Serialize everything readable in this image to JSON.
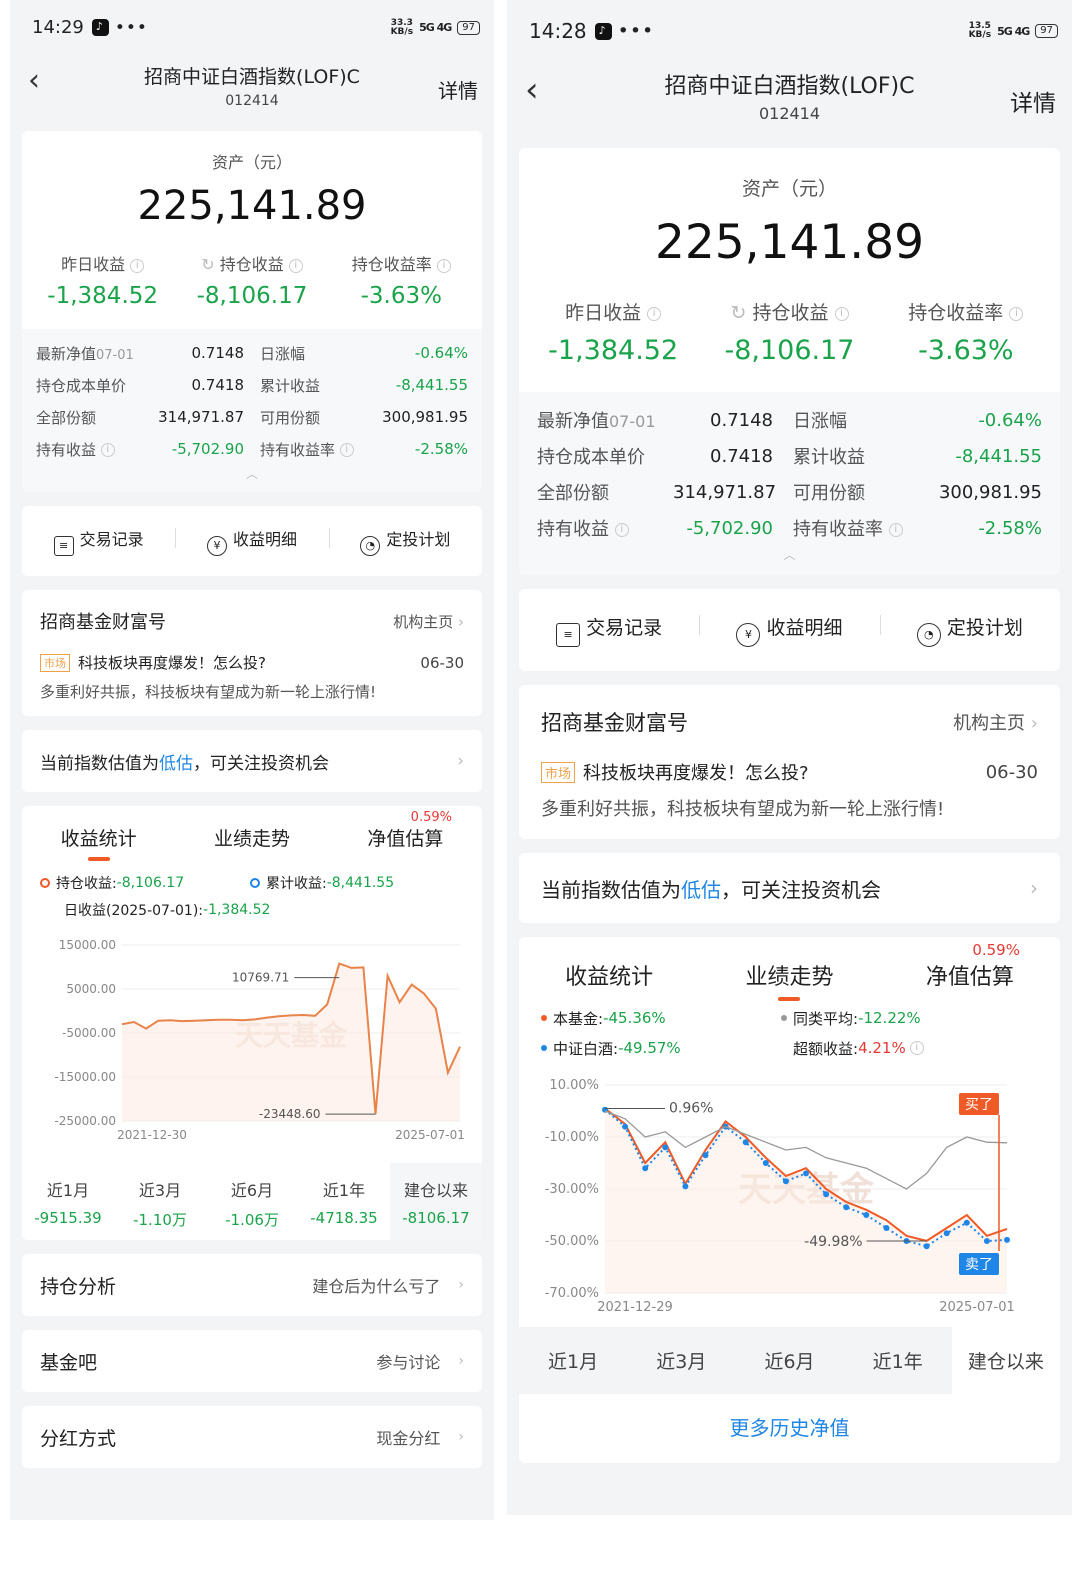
{
  "left": {
    "status": {
      "time": "14:29",
      "speed_top": "33.3",
      "speed_bottom": "KB/s",
      "signal": "5G 4G",
      "battery": "97"
    },
    "nav": {
      "back": "‹",
      "title": "招商中证白酒指数(LOF)C",
      "code": "012414",
      "detail": "详情"
    },
    "asset": {
      "label": "资产（元）",
      "value": "225,141.89"
    },
    "stats": [
      {
        "label": "昨日收益",
        "value": "-1,384.52"
      },
      {
        "label": "持仓收益",
        "value": "-8,106.17"
      },
      {
        "label": "持仓收益率",
        "value": "-3.63%"
      }
    ],
    "grid": [
      {
        "k1": "最新净值",
        "date": "07-01",
        "v1": "0.7148",
        "k2": "日涨幅",
        "v2": "-0.64%"
      },
      {
        "k1": "持仓成本单价",
        "v1": "0.7418",
        "k2": "累计收益",
        "v2": "-8,441.55"
      },
      {
        "k1": "全部份额",
        "v1": "314,971.87",
        "k2": "可用份额",
        "v2": "300,981.95"
      },
      {
        "k1": "持有收益",
        "v1": "-5,702.90",
        "k2": "持有收益率",
        "v2": "-2.58%"
      }
    ],
    "actions": [
      "交易记录",
      "收益明细",
      "定投计划"
    ],
    "wealth": {
      "title": "招商基金财富号",
      "link": "机构主页",
      "tag": "市场",
      "headline": "科技板块再度爆发！怎么投?",
      "date": "06-30",
      "sub": "多重利好共振，科技板块有望成为新一轮上涨行情!"
    },
    "banner": {
      "pre": "当前指数估值为",
      "hl": "低估",
      "post": "，可关注投资机会"
    },
    "tabs": [
      "收益统计",
      "业绩走势",
      "净值估算"
    ],
    "tab_badge": "0.59%",
    "legend": {
      "hold_label": "持仓收益: ",
      "hold_value": "-8,106.17",
      "acc_label": "累计收益: ",
      "acc_value": "-8,441.55",
      "daily_label": "日收益(2025-07-01): ",
      "daily_value": "-1,384.52"
    },
    "periods": [
      {
        "label": "近1月",
        "value": "-9515.39"
      },
      {
        "label": "近3月",
        "value": "-1.10万"
      },
      {
        "label": "近6月",
        "value": "-1.06万"
      },
      {
        "label": "近1年",
        "value": "-4718.35"
      },
      {
        "label": "建仓以来",
        "value": "-8106.17"
      }
    ],
    "rows": [
      {
        "title": "持仓分析",
        "right": "建仓后为什么亏了"
      },
      {
        "title": "基金吧",
        "right": "参与讨论"
      },
      {
        "title": "分红方式",
        "right": "现金分红"
      }
    ]
  },
  "right": {
    "status": {
      "time": "14:28",
      "speed_top": "13.5",
      "speed_bottom": "KB/s",
      "signal": "5G 4G",
      "battery": "97"
    },
    "nav": {
      "back": "‹",
      "title": "招商中证白酒指数(LOF)C",
      "code": "012414",
      "detail": "详情"
    },
    "legend": {
      "fund_label": "本基金: ",
      "fund_value": "-45.36%",
      "peer_label": "同类平均: ",
      "peer_value": "-12.22%",
      "index_label": "中证白酒: ",
      "index_value": "-49.57%",
      "excess_label": "超额收益: ",
      "excess_value": "4.21%"
    },
    "periods": [
      "近1月",
      "近3月",
      "近6月",
      "近1年",
      "建仓以来"
    ],
    "more": "更多历史净值"
  },
  "chart_data": [
    {
      "type": "line",
      "title": "",
      "series": [
        {
          "name": "持仓收益",
          "values": [
            -3000,
            -2500,
            -4000,
            -2200,
            -2100,
            -2300,
            -2200,
            -2100,
            -2000,
            -2000,
            -2100,
            -1900,
            -1500,
            -1200,
            -1000,
            -900,
            -1100,
            1500,
            10769.71,
            9800,
            9900,
            -23448.6,
            8000,
            2000,
            6000,
            4000,
            500,
            -14000,
            -8106.17
          ]
        }
      ],
      "x_start": "2021-12-30",
      "x_end": "2025-07-01",
      "ylim": [
        -25000,
        15000
      ],
      "yticks": [
        "15000.00",
        "5000.00",
        "-5000.00",
        "-15000.00",
        "-25000.00"
      ],
      "max_label": "10769.71",
      "min_label": "-23448.60",
      "watermark": "天天基金"
    },
    {
      "type": "line",
      "title": "",
      "series": [
        {
          "name": "本基金",
          "values": [
            0.96,
            -5,
            -20,
            -12,
            -28,
            -15,
            -4,
            -10,
            -18,
            -25,
            -22,
            -30,
            -35,
            -38,
            -42,
            -48,
            -49.98,
            -45,
            -40,
            -48,
            -45.36
          ]
        },
        {
          "name": "中证白酒",
          "values": [
            0.5,
            -6,
            -22,
            -14,
            -29,
            -17,
            -6,
            -12,
            -20,
            -27,
            -24,
            -32,
            -37,
            -40,
            -45,
            -50,
            -52,
            -47,
            -43,
            -50,
            -49.57
          ]
        },
        {
          "name": "同类平均",
          "values": [
            0,
            -3,
            -10,
            -8,
            -14,
            -10,
            -6,
            -9,
            -12,
            -15,
            -14,
            -18,
            -20,
            -22,
            -26,
            -30,
            -24,
            -14,
            -10,
            -12,
            -12.22
          ]
        }
      ],
      "x_start": "2021-12-29",
      "x_end": "2025-07-01",
      "ylim": [
        -70,
        10
      ],
      "yticks": [
        "10.00%",
        "-10.00%",
        "-30.00%",
        "-50.00%",
        "-70.00%"
      ],
      "max_label": "0.96%",
      "min_label": "-49.98%",
      "buy_label": "买了",
      "sell_label": "卖了",
      "watermark": "天天基金"
    }
  ],
  "colors": {
    "green": "#1aa34a",
    "red": "#e53935",
    "orange": "#f05a26",
    "blue": "#1f86e6",
    "line_orange": "#e8834a"
  }
}
